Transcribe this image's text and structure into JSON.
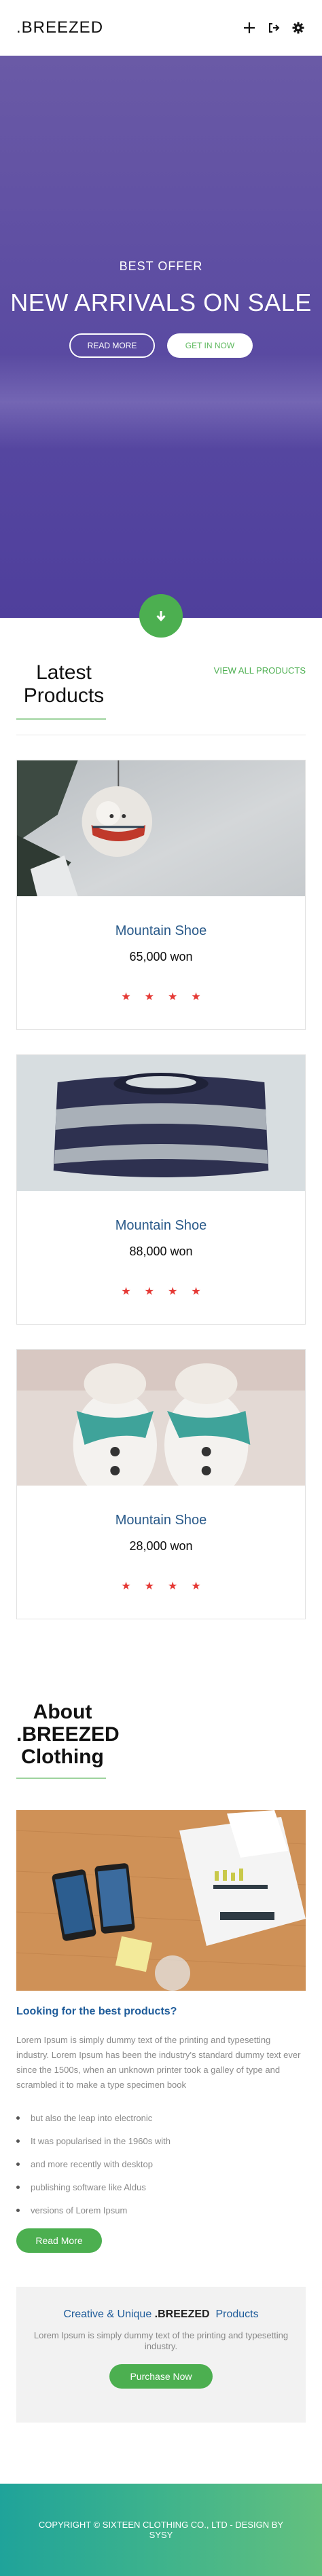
{
  "header": {
    "logo": ".BREEZED",
    "icons": [
      "plus-icon",
      "sign-out-icon",
      "gear-icon"
    ]
  },
  "hero": {
    "subtitle": "BEST OFFER",
    "title": "NEW ARRIVALS ON SALE",
    "read_more": "READ MORE",
    "get_in_now": "GET IN NOW",
    "scroll_icon": "arrow-down-icon"
  },
  "latest": {
    "view_all": "VIEW ALL PRODUCTS",
    "title_line1": "Latest",
    "title_line2": "Products",
    "products": [
      {
        "name": "Mountain Shoe",
        "price": "65,000 won",
        "stars": 4,
        "image": "ornament-image"
      },
      {
        "name": "Mountain Shoe",
        "price": "88,000 won",
        "stars": 4,
        "image": "sweater-image"
      },
      {
        "name": "Mountain Shoe",
        "price": "28,000 won",
        "stars": 4,
        "image": "snowmen-image"
      }
    ]
  },
  "about": {
    "title_line1": "About",
    "title_line2": ".BREEZED",
    "title_line3": "Clothing",
    "question": "Looking for the best products?",
    "paragraph": "Lorem Ipsum is simply dummy text of the printing and typesetting industry. Lorem Ipsum has been the industry's standard dummy text ever since the 1500s, when an unknown printer took a galley of type and scrambled it to make a type specimen book",
    "list": [
      "but also the leap into electronic",
      "It was popularised in the 1960s with",
      "and more recently with desktop",
      "publishing software like Aldus",
      "versions of Lorem Ipsum"
    ],
    "read_more": "Read More"
  },
  "cta": {
    "title_pre": "Creative & Unique ",
    "title_brand": ".BREEZED",
    "title_post": "  Products",
    "text": "Lorem Ipsum is simply dummy text of the printing and typesetting industry.",
    "button": "Purchase Now"
  },
  "footer": {
    "line1": "COPYRIGHT © SIXTEEN CLOTHING CO., LTD - DESIGN BY",
    "line2": "SYSY"
  },
  "colors": {
    "accent": "#4caf50",
    "hero_purple": "#5546a0",
    "product_name": "#2a5a8a",
    "star": "#e53935",
    "footer_teal": "#1fa39a"
  }
}
